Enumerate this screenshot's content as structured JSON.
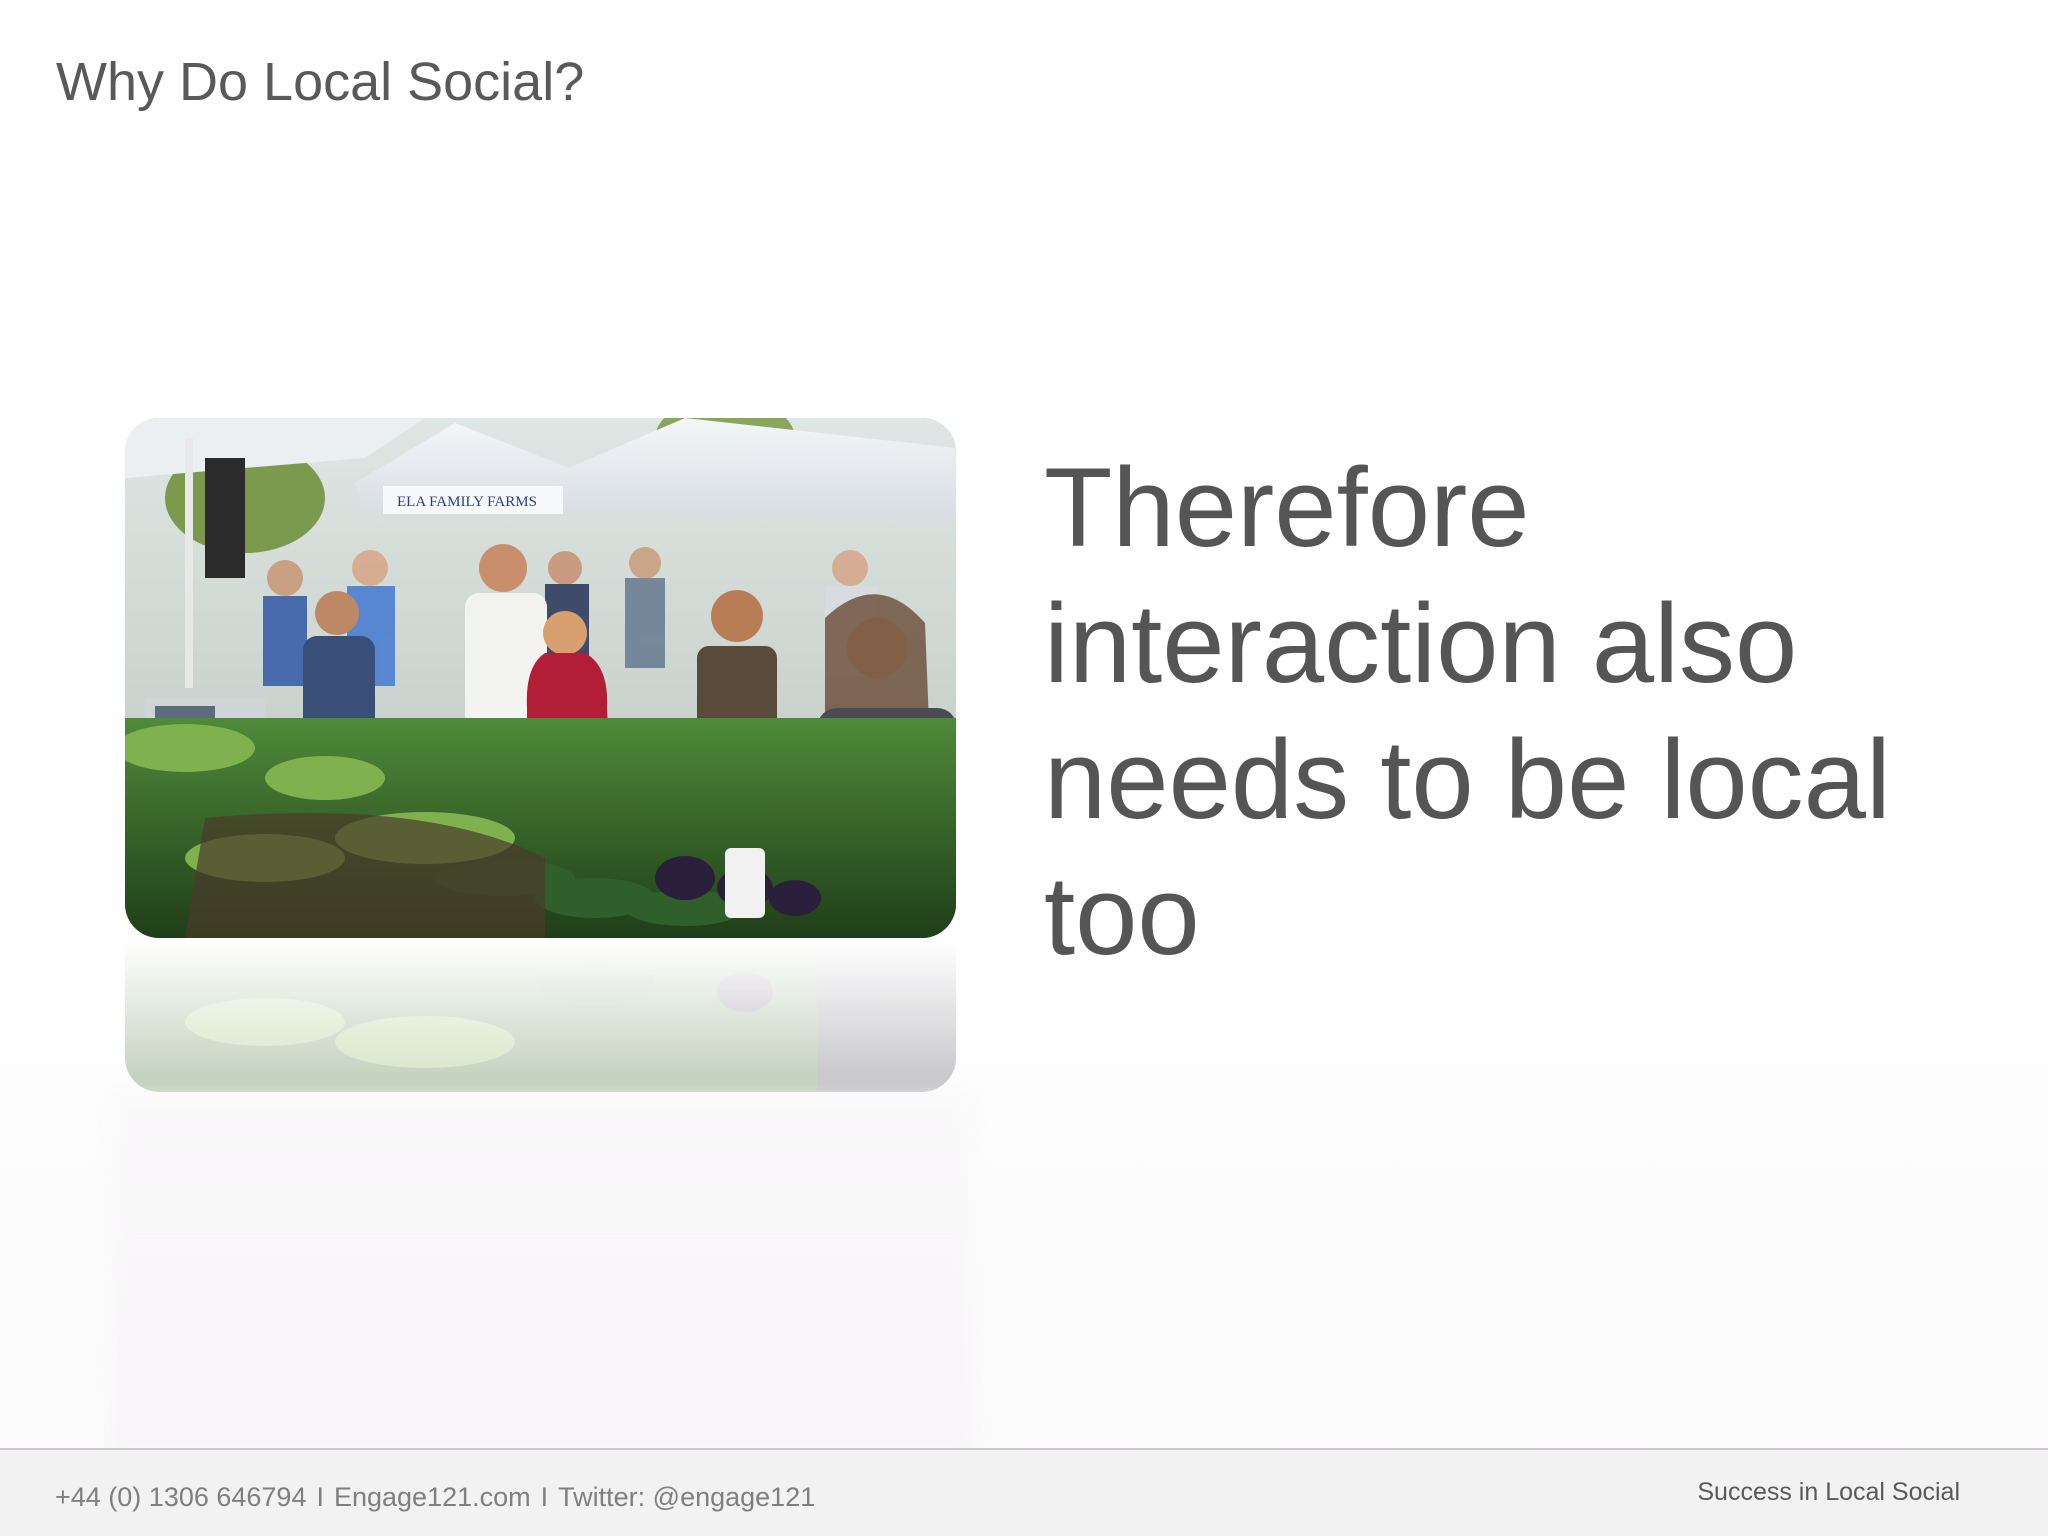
{
  "slide": {
    "title": "Why Do Local Social?",
    "headline": "Therefore interaction also needs to be local too",
    "image": {
      "subject": "farmers-market-crowd",
      "sign_text": "ELA FAMILY FARMS"
    }
  },
  "footer": {
    "phone": "+44 (0) 1306 646794",
    "website": "Engage121.com",
    "twitter": "Twitter: @engage121",
    "separator": "I",
    "tagline": "Success in Local Social"
  },
  "colors": {
    "text_primary": "#595959",
    "text_muted": "#7f7f7f",
    "footer_bg": "#f2f2f2",
    "footer_rule": "#c9c9c9"
  }
}
